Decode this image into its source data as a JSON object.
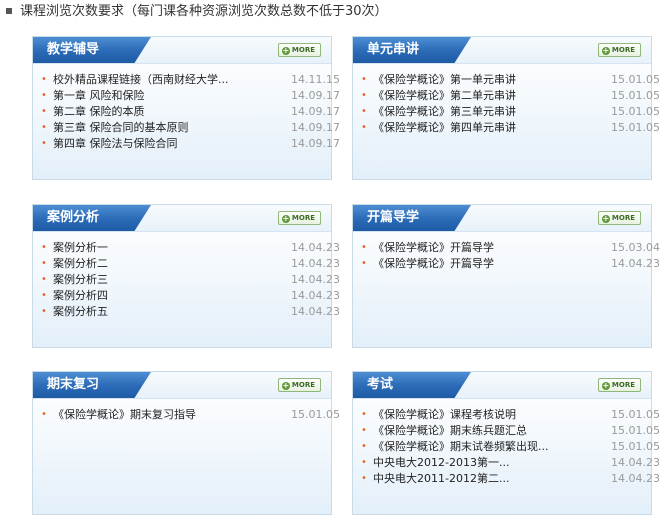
{
  "page": {
    "heading": "课程浏览次数要求（每门课各种资源浏览次数总数不低于30次）"
  },
  "more_label": "MORE",
  "panels": [
    {
      "title": "教学辅导",
      "items": [
        {
          "title": "校外精品课程链接（西南财经大学...",
          "date": "14.11.15"
        },
        {
          "title": "第一章 风险和保险",
          "date": "14.09.17"
        },
        {
          "title": "第二章 保险的本质",
          "date": "14.09.17"
        },
        {
          "title": "第三章 保险合同的基本原则",
          "date": "14.09.17"
        },
        {
          "title": "第四章 保险法与保险合同",
          "date": "14.09.17"
        }
      ]
    },
    {
      "title": "单元串讲",
      "items": [
        {
          "title": "《保险学概论》第一单元串讲",
          "date": "15.01.05"
        },
        {
          "title": "《保险学概论》第二单元串讲",
          "date": "15.01.05"
        },
        {
          "title": "《保险学概论》第三单元串讲",
          "date": "15.01.05"
        },
        {
          "title": "《保险学概论》第四单元串讲",
          "date": "15.01.05"
        }
      ]
    },
    {
      "title": "案例分析",
      "items": [
        {
          "title": "案例分析一",
          "date": "14.04.23"
        },
        {
          "title": "案例分析二",
          "date": "14.04.23"
        },
        {
          "title": "案例分析三",
          "date": "14.04.23"
        },
        {
          "title": "案例分析四",
          "date": "14.04.23"
        },
        {
          "title": "案例分析五",
          "date": "14.04.23"
        }
      ]
    },
    {
      "title": "开篇导学",
      "items": [
        {
          "title": "《保险学概论》开篇导学",
          "date": "15.03.04"
        },
        {
          "title": "《保险学概论》开篇导学",
          "date": "14.04.23"
        }
      ]
    },
    {
      "title": "期末复习",
      "items": [
        {
          "title": "《保险学概论》期末复习指导",
          "date": "15.01.05"
        }
      ]
    },
    {
      "title": "考试",
      "items": [
        {
          "title": "《保险学概论》课程考核说明",
          "date": "15.01.05"
        },
        {
          "title": "《保险学概论》期末练兵题汇总",
          "date": "15.01.05"
        },
        {
          "title": "《保险学概论》期末试卷频繁出现...",
          "date": "15.01.05"
        },
        {
          "title": "中央电大2012-2013第一...",
          "date": "14.04.23"
        },
        {
          "title": "中央电大2011-2012第二...",
          "date": "14.04.23"
        }
      ]
    }
  ]
}
